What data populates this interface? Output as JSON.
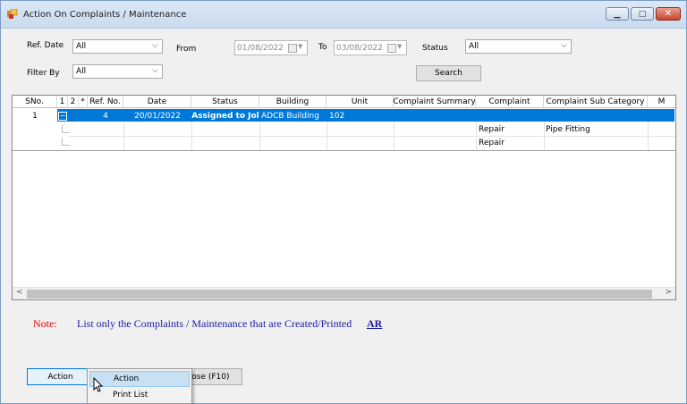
{
  "window": {
    "title": "Action On Complaints / Maintenance",
    "accent": "#0078d7"
  },
  "filters": {
    "ref_date_label": "Ref. Date",
    "ref_date_value": "All",
    "from_label": "From",
    "from_value": "01/08/2022",
    "to_label": "To",
    "to_value": "03/08/2022",
    "status_label": "Status",
    "status_value": "All",
    "filter_by_label": "Filter By",
    "filter_by_value": "All",
    "search_label": "Search"
  },
  "grid": {
    "columns": [
      "SNo.",
      "1",
      "2",
      "*",
      "Ref. No.",
      "Date",
      "Status",
      "Building",
      "Unit",
      "Complaint Summary",
      "Complaint",
      "Complaint Sub Category",
      "M"
    ],
    "row": {
      "sno": "1",
      "expander": "−",
      "ref_no": "4",
      "date": "20/01/2022",
      "status": "Assigned to Jol",
      "building": "ADCB Building",
      "unit": "102"
    },
    "sub_rows": [
      {
        "complaint": "Repair",
        "sub_category": "Pipe Fitting"
      },
      {
        "complaint": "Repair",
        "sub_category": ""
      }
    ]
  },
  "note": {
    "label": "Note:",
    "text": "List only the Complaints / Maintenance that are Created/Printed",
    "link": "AR"
  },
  "buttons": {
    "action": "Action",
    "close": "Close (F10)"
  },
  "context_menu": {
    "items": [
      "Action",
      "Print List"
    ]
  },
  "icons": {
    "app": "app-icon",
    "minimize": "minimize-icon",
    "maximize": "maximize-icon",
    "close": "close-icon"
  }
}
